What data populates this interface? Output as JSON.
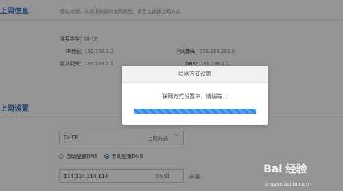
{
  "internet_info": {
    "title": "上网信息",
    "hint": "经过检测，无法识别您的上网类型，请手工选择上网方式",
    "conn_type_label": "连接类型：",
    "conn_type_value": "DHCP",
    "ip_label": "IP地址：",
    "ip_value": "192.168.1.2",
    "gateway_label": "默认网关：",
    "gateway_value": "192.168.1.1",
    "mask_label": "子网掩码：",
    "mask_value": "255.255.255.0",
    "dns_label": "DNS：",
    "dns_value": "192.168.1.1"
  },
  "internet_settings": {
    "title": "上网设置",
    "select_value": "DHCP",
    "select_label": "上网方式",
    "radio_auto": "自动配置DNS",
    "radio_manual": "手动配置DNS",
    "dns1_value": "114.114.114.114",
    "dns1_label": "DNS1",
    "required": "必填"
  },
  "modal": {
    "title": "联网方式设置",
    "message": "联网方式设置中，请稍等...",
    "progress": 1.0
  },
  "watermark": {
    "brand": "Bai  经验",
    "url": "jingyan.baidu.com"
  }
}
